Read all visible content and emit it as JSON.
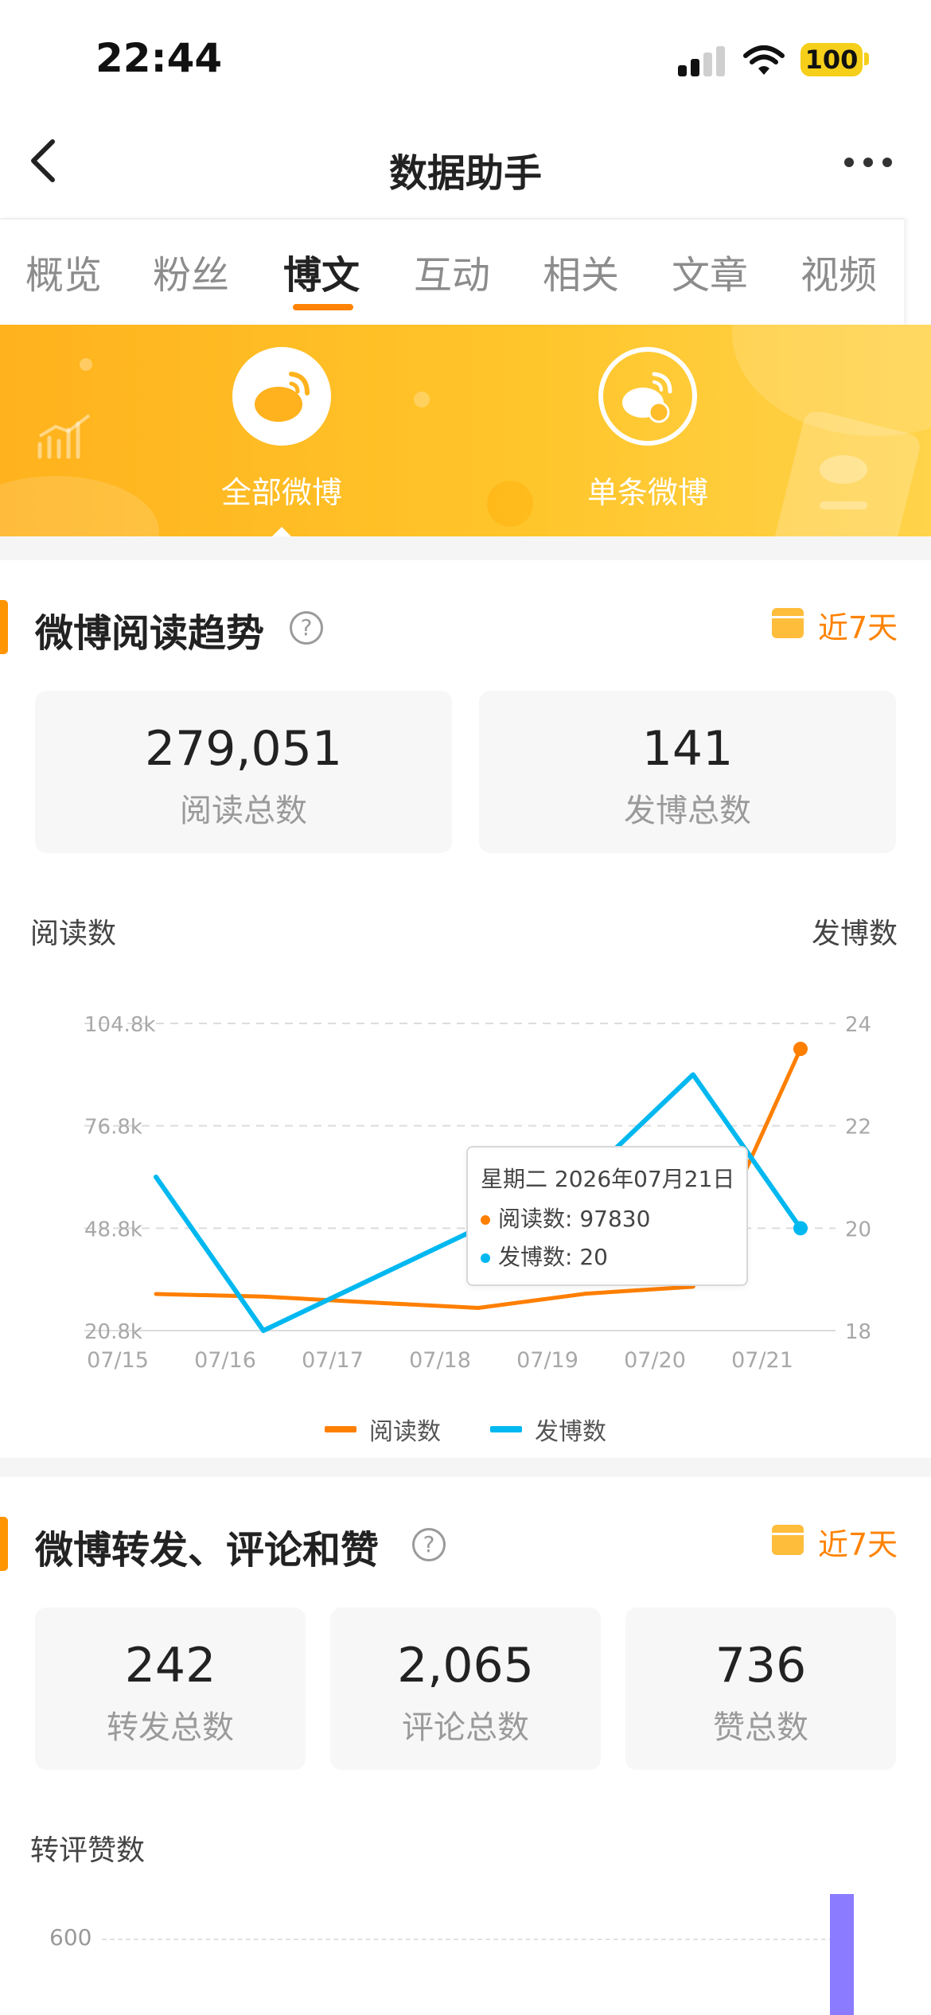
{
  "status": {
    "time": "22:44",
    "battery": "100"
  },
  "nav": {
    "title": "数据助手"
  },
  "tabs": [
    {
      "label": "概览"
    },
    {
      "label": "粉丝"
    },
    {
      "label": "博文",
      "active": true
    },
    {
      "label": "互动"
    },
    {
      "label": "相关"
    },
    {
      "label": "文章"
    },
    {
      "label": "视频"
    }
  ],
  "banner": {
    "all_label": "全部微博",
    "single_label": "单条微博",
    "selected": "全部微博"
  },
  "read_section": {
    "title": "微博阅读趋势",
    "range": "近7天",
    "stats": [
      {
        "value": "279,051",
        "label": "阅读总数"
      },
      {
        "value": "141",
        "label": "发博总数"
      }
    ],
    "left_axis_label": "阅读数",
    "right_axis_label": "发博数"
  },
  "chart_data": {
    "type": "line",
    "categories": [
      "07/15",
      "07/16",
      "07/17",
      "07/18",
      "07/19",
      "07/20",
      "07/21"
    ],
    "left_ticks": [
      "104.8k",
      "76.8k",
      "48.8k",
      "20.8k"
    ],
    "right_ticks": [
      "24",
      "22",
      "20",
      "18"
    ],
    "left_ylim": [
      20800,
      104800
    ],
    "right_ylim": [
      18,
      24
    ],
    "series": [
      {
        "name": "阅读数",
        "axis": "left",
        "color": "#ff7f00",
        "values": [
          30800,
          30100,
          28500,
          27000,
          30900,
          32800,
          97830
        ]
      },
      {
        "name": "发博数",
        "axis": "right",
        "color": "#00b8f0",
        "values": [
          21,
          18,
          19,
          20,
          21,
          23,
          20
        ]
      }
    ],
    "grid": true,
    "legend": "bottom-center",
    "tooltip": {
      "title": "星期二 2026年07月21日",
      "rows": [
        "阅读数: 97830",
        "发博数: 20"
      ]
    }
  },
  "interact_section": {
    "title": "微博转发、评论和赞",
    "range": "近7天",
    "stats": [
      {
        "value": "242",
        "label": "转发总数"
      },
      {
        "value": "2,065",
        "label": "评论总数"
      },
      {
        "value": "736",
        "label": "赞总数"
      }
    ],
    "axis_label": "转评赞数",
    "tick_600": "600"
  },
  "colors": {
    "accent": "#ff8200",
    "banner": "#ffbd2a",
    "read_line": "#ff7f00",
    "post_line": "#00b8f0",
    "bar": "#8b7cff"
  }
}
